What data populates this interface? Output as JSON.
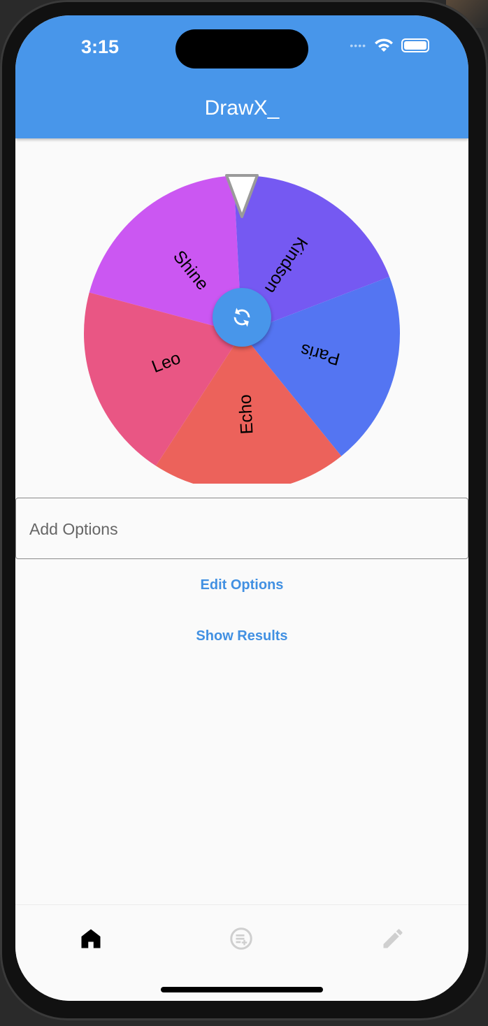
{
  "status": {
    "time": "3:15"
  },
  "app": {
    "title": "DrawX_"
  },
  "wheel": {
    "segments": [
      {
        "label": "Shine",
        "color": "#cb57f2"
      },
      {
        "label": "Kindson",
        "color": "#7559f2"
      },
      {
        "label": "Paris",
        "color": "#5475f2"
      },
      {
        "label": "Echo",
        "color": "#ec625b"
      },
      {
        "label": "Leo",
        "color": "#e95684"
      }
    ],
    "spin_icon": "sync-icon"
  },
  "input": {
    "placeholder": "Add Options",
    "value": ""
  },
  "actions": {
    "edit_label": "Edit Options",
    "results_label": "Show Results"
  },
  "nav": [
    {
      "icon": "home-icon",
      "active": true
    },
    {
      "icon": "playlist-add-icon",
      "active": false
    },
    {
      "icon": "edit-icon",
      "active": false
    }
  ],
  "colors": {
    "primary": "#4896ea",
    "link": "#4190e2"
  }
}
